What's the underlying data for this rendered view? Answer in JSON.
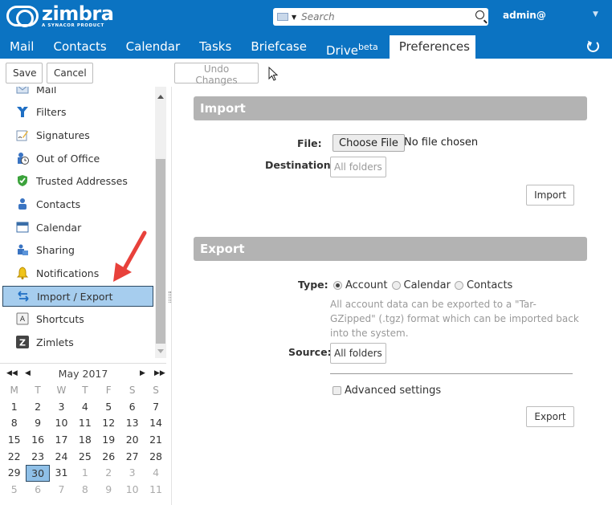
{
  "header": {
    "logo": {
      "name": "zimbra",
      "tagline": "A SYNACOR PRODUCT"
    },
    "search": {
      "placeholder": "Search",
      "type_icon": "envelope-icon"
    },
    "user": "admin@",
    "brand_color": "#0b73c2"
  },
  "tabs": [
    {
      "label": "Mail"
    },
    {
      "label": "Contacts"
    },
    {
      "label": "Calendar"
    },
    {
      "label": "Tasks"
    },
    {
      "label": "Briefcase"
    },
    {
      "label": "Drive",
      "sup": "beta"
    },
    {
      "label": "Preferences",
      "active": true
    }
  ],
  "toolbar": {
    "save": "Save",
    "cancel": "Cancel",
    "undo": "Undo Changes"
  },
  "sidebar": {
    "items": [
      {
        "label": "Mail",
        "icon": "mail-icon"
      },
      {
        "label": "Filters",
        "icon": "filter-icon"
      },
      {
        "label": "Signatures",
        "icon": "signature-icon"
      },
      {
        "label": "Out of Office",
        "icon": "out-of-office-icon"
      },
      {
        "label": "Trusted Addresses",
        "icon": "shield-check-icon"
      },
      {
        "label": "Contacts",
        "icon": "contact-icon"
      },
      {
        "label": "Calendar",
        "icon": "calendar-icon"
      },
      {
        "label": "Sharing",
        "icon": "sharing-icon"
      },
      {
        "label": "Notifications",
        "icon": "bell-icon"
      },
      {
        "label": "Import / Export",
        "icon": "import-export-icon",
        "active": true
      },
      {
        "label": "Shortcuts",
        "icon": "keyboard-key-icon"
      },
      {
        "label": "Zimlets",
        "icon": "zimlet-icon"
      }
    ]
  },
  "calendar": {
    "title": "May 2017",
    "weekdays": [
      "M",
      "T",
      "W",
      "T",
      "F",
      "S",
      "S"
    ],
    "weeks": [
      [
        "1",
        "2",
        "3",
        "4",
        "5",
        "6",
        "7"
      ],
      [
        "8",
        "9",
        "10",
        "11",
        "12",
        "13",
        "14"
      ],
      [
        "15",
        "16",
        "17",
        "18",
        "19",
        "20",
        "21"
      ],
      [
        "22",
        "23",
        "24",
        "25",
        "26",
        "27",
        "28"
      ],
      [
        "29",
        "30",
        "31",
        "1",
        "2",
        "3",
        "4"
      ],
      [
        "5",
        "6",
        "7",
        "8",
        "9",
        "10",
        "11"
      ]
    ],
    "selected": "30"
  },
  "import": {
    "title": "Import",
    "file_label": "File:",
    "choose_file": "Choose File",
    "no_file": "No file chosen",
    "destination_label": "Destination:",
    "destination_value": "All folders",
    "button": "Import"
  },
  "export": {
    "title": "Export",
    "type_label": "Type:",
    "types": [
      {
        "label": "Account",
        "checked": true
      },
      {
        "label": "Calendar",
        "checked": false
      },
      {
        "label": "Contacts",
        "checked": false
      }
    ],
    "hint": "All account data can be exported to a \"Tar-GZipped\" (.tgz) format which can be imported back into the system.",
    "source_label": "Source:",
    "source_value": "All folders",
    "advanced": "Advanced settings",
    "button": "Export"
  }
}
